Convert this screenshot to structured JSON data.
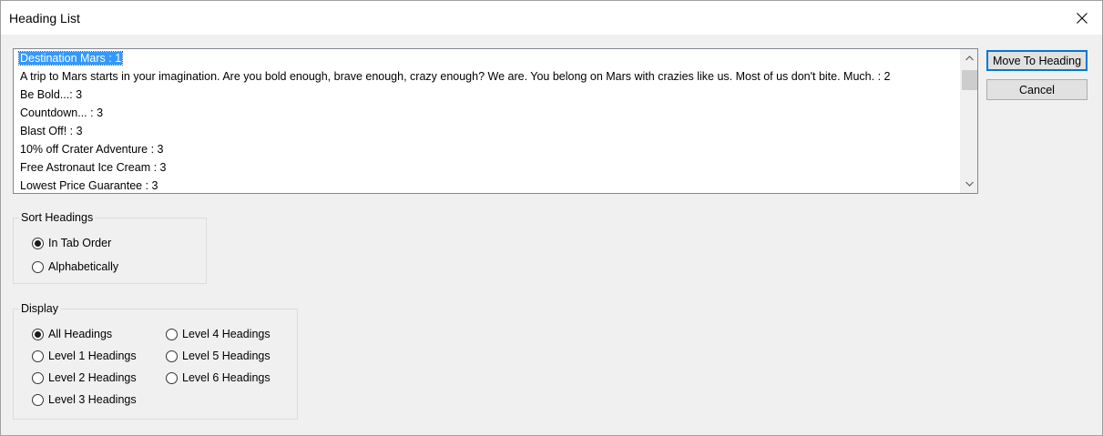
{
  "window": {
    "title": "Heading List"
  },
  "headings": [
    "Destination Mars  : 1",
    "A trip to Mars starts in your imagination. Are you bold enough, brave enough, crazy enough? We are. You belong on Mars with crazies like us. Most of us don't bite. Much. : 2",
    "Be Bold...: 3",
    "Countdown... : 3",
    "Blast Off! : 3",
    "10% off Crater Adventure : 3",
    "Free Astronaut Ice Cream : 3",
    "Lowest Price Guarantee : 3"
  ],
  "selected_index": 0,
  "buttons": {
    "move": "Move To Heading",
    "cancel": "Cancel"
  },
  "sort": {
    "label": "Sort Headings",
    "options": [
      "In Tab Order",
      "Alphabetically"
    ],
    "selected": 0
  },
  "display": {
    "label": "Display",
    "options": [
      "All Headings",
      "Level 1 Headings",
      "Level 2 Headings",
      "Level 3 Headings",
      "Level 4 Headings",
      "Level 5 Headings",
      "Level 6 Headings"
    ],
    "selected": 0
  },
  "icons": {
    "close": "close-icon",
    "up": "chevron-up-icon",
    "down": "chevron-down-icon"
  },
  "colors": {
    "selection": "#3399ff",
    "default_button_border": "#0078d7"
  }
}
